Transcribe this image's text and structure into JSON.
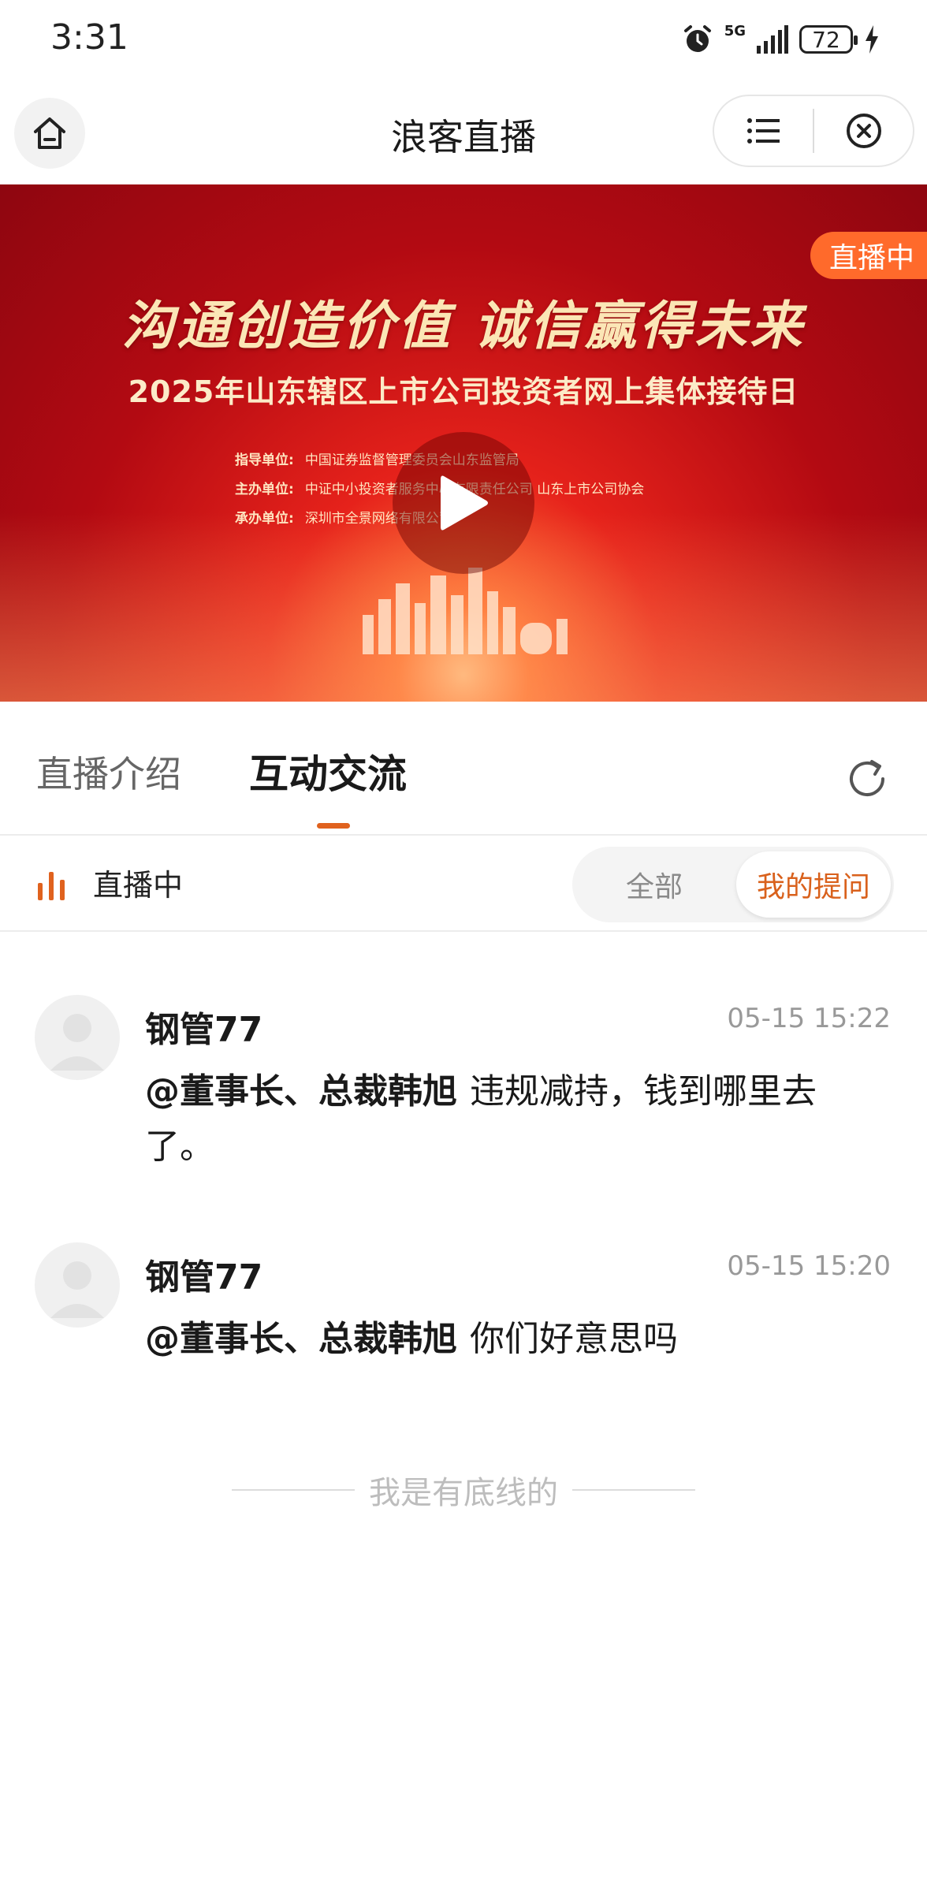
{
  "status_bar": {
    "time": "3:31",
    "network": "5G",
    "battery": "72"
  },
  "header": {
    "title": "浪客直播",
    "icons": {
      "home": "home-icon",
      "menu": "list-icon",
      "close": "close-circle-icon"
    }
  },
  "banner": {
    "live_badge": "直播中",
    "slogan": "沟通创造价值 诚信赢得未来",
    "headline": "2025年山东辖区上市公司投资者网上集体接待日",
    "info": [
      {
        "key": "指导单位:",
        "value": "中国证券监督管理委员会山东监管局"
      },
      {
        "key": "主办单位:",
        "value": "中证中小投资者服务中心有限责任公司  山东上市公司协会"
      },
      {
        "key": "承办单位:",
        "value": "深圳市全景网络有限公司"
      }
    ]
  },
  "tabs": {
    "intro": "直播介绍",
    "chat": "互动交流",
    "active": "chat"
  },
  "filter": {
    "live_label": "直播中",
    "all": "全部",
    "mine": "我的提问",
    "selected": "mine"
  },
  "comments": [
    {
      "user": "钢管77",
      "time": "05-15 15:22",
      "mention": "@董事长、总裁韩旭",
      "text": "违规减持，钱到哪里去了。"
    },
    {
      "user": "钢管77",
      "time": "05-15 15:20",
      "mention": "@董事长、总裁韩旭",
      "text": "你们好意思吗"
    }
  ],
  "footer": {
    "text": "我是有底线的"
  },
  "colors": {
    "accent": "#e0621e",
    "live_badge": "#ff6a2b",
    "banner_red": "#d0161a"
  }
}
